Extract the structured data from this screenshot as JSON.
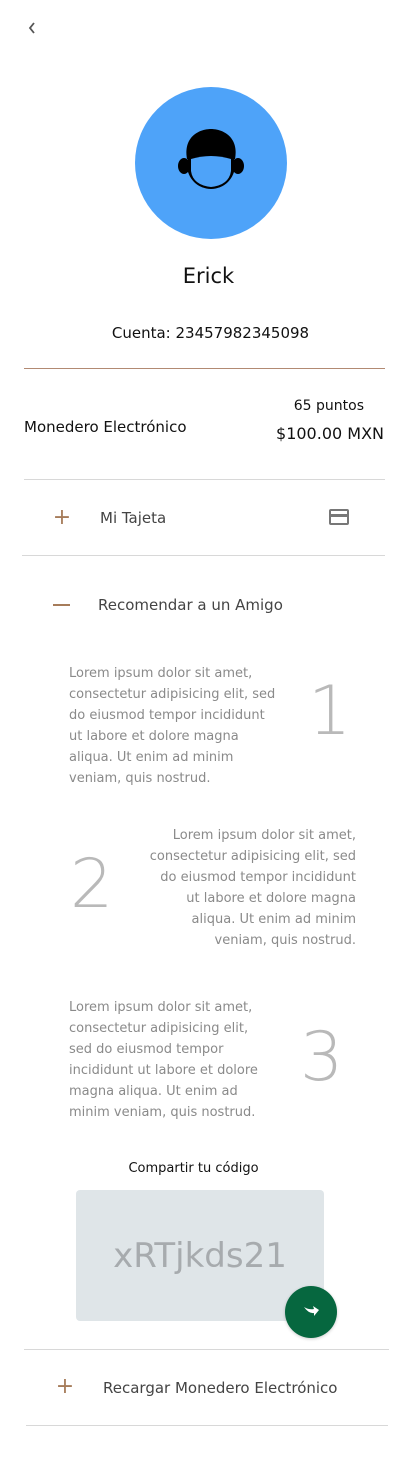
{
  "nav": {
    "back_icon": "chevron-left-icon"
  },
  "profile": {
    "avatar_icon": "user-face-icon",
    "avatar_color": "#4ea3f9",
    "name": "Erick",
    "account": "Cuenta: 23457982345098"
  },
  "wallet": {
    "label": "Monedero Electrónico",
    "points": "65 puntos",
    "balance": "$100.00 MXN"
  },
  "sections": {
    "card": {
      "label": "Mi Tajeta",
      "toggle_icon": "plus-icon",
      "right_icon": "credit-card-icon"
    },
    "recommend": {
      "label": "Recomendar a un Amigo",
      "toggle_icon": "minus-icon"
    },
    "reload": {
      "label": "Recargar Monedero Electrónico",
      "toggle_icon": "plus-icon"
    }
  },
  "steps": [
    {
      "number": "1",
      "text": "Lorem ipsum dolor sit amet, consectetur adipisicing elit, sed do eiusmod tempor incididunt ut labore et dolore magna aliqua. Ut enim ad minim veniam, quis nostrud."
    },
    {
      "number": "2",
      "text": "Lorem ipsum dolor sit amet, consectetur adipisicing elit, sed do eiusmod tempor incididunt ut labore et dolore magna aliqua. Ut enim ad minim veniam, quis nostrud."
    },
    {
      "number": "3",
      "text": "Lorem ipsum dolor sit amet, consectetur adipisicing elit, sed do eiusmod tempor incididunt ut labore et dolore magna aliqua. Ut enim ad minim veniam, quis nostrud."
    }
  ],
  "share": {
    "title": "Compartir tu código",
    "code": "xRTjkds21",
    "button_icon": "share-arrow-icon",
    "button_color": "#06673f"
  },
  "colors": {
    "accent": "#a67c5a",
    "divider_accent": "#b28a73"
  }
}
